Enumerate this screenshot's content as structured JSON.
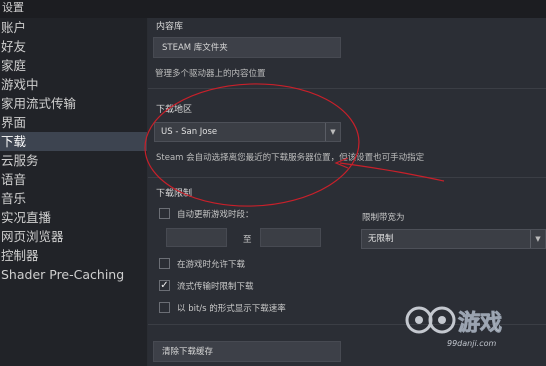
{
  "window": {
    "title": "设置"
  },
  "sidebar": {
    "items": [
      {
        "label": "账户"
      },
      {
        "label": "好友"
      },
      {
        "label": "家庭"
      },
      {
        "label": "游戏中"
      },
      {
        "label": "家用流式传输"
      },
      {
        "label": "界面"
      },
      {
        "label": "下载"
      },
      {
        "label": "云服务"
      },
      {
        "label": "语音"
      },
      {
        "label": "音乐"
      },
      {
        "label": "实况直播"
      },
      {
        "label": "网页浏览器"
      },
      {
        "label": "控制器"
      },
      {
        "label": "Shader Pre-Caching"
      }
    ],
    "active": "下载"
  },
  "content_library": {
    "title": "内容库",
    "button_label": "STEAM 库文件夹",
    "description": "管理多个驱动器上的内容位置"
  },
  "download_region": {
    "title": "下载地区",
    "selected": "US - San Jose",
    "description": "Steam 会自动选择离您最近的下载服务器位置，但该设置也可手动指定"
  },
  "download_limits": {
    "title": "下载限制",
    "auto_update_label": "自动更新游戏时段：",
    "auto_update_checked": false,
    "to_label": "至",
    "bandwidth_label": "限制带宽为",
    "bandwidth_value": "无限制",
    "allow_during_game_label": "在游戏时允许下载",
    "allow_during_game_checked": false,
    "throttle_streaming_label": "流式传输时限制下载",
    "throttle_streaming_checked": true,
    "bits_display_label": "以 bit/s 的形式显示下载速率",
    "bits_display_checked": false,
    "checkmark": "✓"
  },
  "clear_cache": {
    "button_label": "清除下载缓存"
  },
  "annotation": {
    "color": "#c8202a"
  },
  "watermark": {
    "text": "99danji.com"
  }
}
